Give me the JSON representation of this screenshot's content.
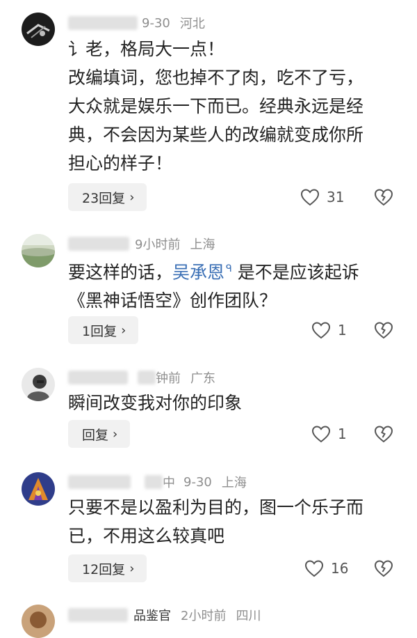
{
  "comments": [
    {
      "meta": {
        "time": "9-30",
        "location": "河北"
      },
      "body_lines": [
        "讠老，格局大一点！",
        "改编填词，您也掉不了肉，吃不了亏，",
        "大众就是娱乐一下而已。经典永远是经",
        "典，不会因为某些人的改编就变成你所",
        "担心的样子！"
      ],
      "reply_label": "23回复",
      "likes": "31"
    },
    {
      "meta": {
        "time": "9小时前",
        "location": "上海"
      },
      "body_prefix": "要这样的话，",
      "mention": "吴承恩",
      "body_suffix": " 是不是应该起诉",
      "body_line2": "《黑神话悟空》创作团队？",
      "reply_label": "1回复",
      "likes": "1"
    },
    {
      "meta": {
        "time": "钟前",
        "location": "广东"
      },
      "body_lines": [
        "瞬间改变我对你的印象"
      ],
      "reply_label": "回复",
      "likes": "1"
    },
    {
      "meta": {
        "name_fragment": "中",
        "time": "9-30",
        "location": "上海"
      },
      "body_lines": [
        "只要不是以盈利为目的，图一个乐子而",
        "已，不用这么较真吧"
      ],
      "reply_label": "12回复",
      "likes": "16"
    },
    {
      "meta": {
        "name_fragment": "品鉴官",
        "time": "2小时前",
        "location": "四川"
      }
    }
  ],
  "icons": {
    "like": "heart-outline-icon",
    "dislike": "broken-heart-icon",
    "chevron": "chevron-right-icon"
  },
  "colors": {
    "mention": "#3a6fb5",
    "meta": "#8e8e8e",
    "reply_bg": "#f1f1f1"
  }
}
